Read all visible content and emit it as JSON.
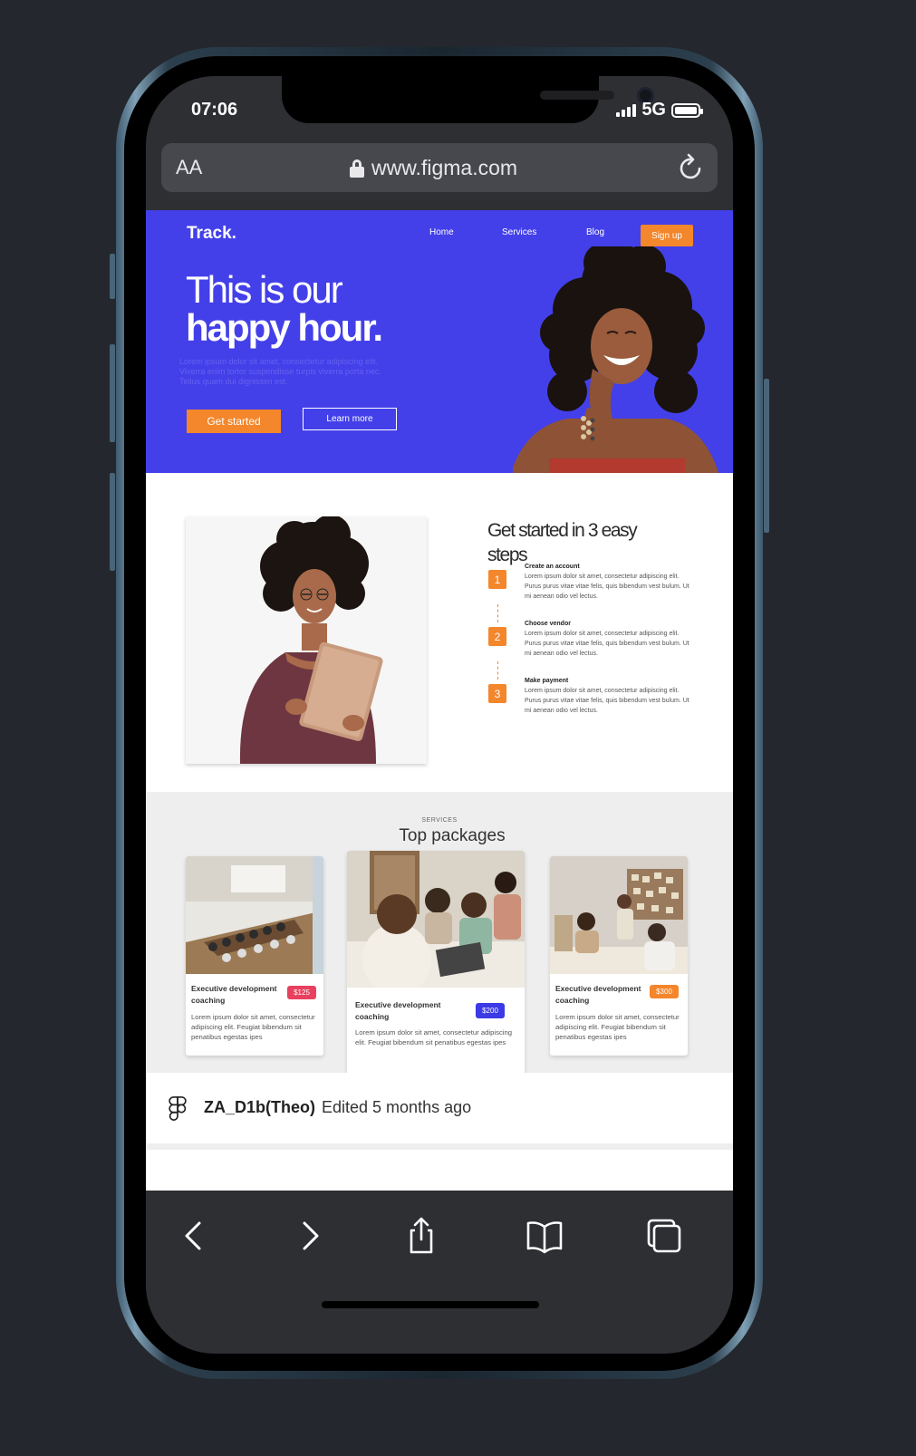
{
  "status_bar": {
    "time": "07:06",
    "network": "5G"
  },
  "browser": {
    "aa_label": "AA",
    "url": "www.figma.com"
  },
  "site": {
    "logo": "Track.",
    "nav": [
      "Home",
      "Services",
      "Blog"
    ],
    "signup": "Sign up",
    "hero": {
      "title_line1": "This is our",
      "title_line2": "happy hour.",
      "paragraph": "Lorem ipsum dolor sit amet, consectetur adipiscing elit. Viverra enim tortor suspendisse turpis viverra porta nec. Tellus quam dui dignissim est.",
      "primary_button": "Get started",
      "secondary_button": "Learn more"
    },
    "steps": {
      "title": "Get started in 3 easy steps",
      "items": [
        {
          "number": "1",
          "title": "Create an account",
          "text": "Lorem ipsum dolor sit amet, consectetur adipiscing elit. Purus purus vitae vitae felis, quis bibendum vest bulum. Ut mi aenean odio vel lectus."
        },
        {
          "number": "2",
          "title": "Choose vendor",
          "text": "Lorem ipsum dolor sit amet, consectetur adipiscing elit. Purus purus vitae vitae felis, quis bibendum vest bulum. Ut mi aenean odio vel lectus."
        },
        {
          "number": "3",
          "title": "Make payment",
          "text": "Lorem ipsum dolor sit amet, consectetur adipiscing elit. Purus purus vitae vitae felis, quis bibendum vest bulum. Ut mi aenean odio vel lectus."
        }
      ]
    },
    "services": {
      "kicker": "SERVICES",
      "title": "Top packages",
      "cards": [
        {
          "name": "Executive development coaching",
          "price": "$125",
          "price_color": "#e8415f",
          "text": "Lorem ipsum dolor sit amet, consectetur adipiscing elit. Feugiat bibendum sit penatibus egestas ipes"
        },
        {
          "name": "Executive development coaching",
          "price": "$200",
          "price_color": "#3b3ae6",
          "text": "Lorem ipsum dolor sit amet, consectetur adipiscing elit. Feugiat bibendum sit penatibus egestas ipes"
        },
        {
          "name": "Executive development coaching",
          "price": "$300",
          "price_color": "#f4862b",
          "text": "Lorem ipsum dolor sit amet, consectetur adipiscing elit. Feugiat bibendum sit penatibus egestas ipes"
        }
      ]
    }
  },
  "figma_bar": {
    "file_name": "ZA_D1b(Theo)",
    "edited": "Edited 5 months ago"
  },
  "toolbar": {
    "icons": [
      "back-icon",
      "forward-icon",
      "share-icon",
      "bookmarks-icon",
      "tabs-icon"
    ]
  },
  "colors": {
    "hero_bg": "#4340e9",
    "accent": "#f4862b",
    "device_bg": "#24272d"
  }
}
